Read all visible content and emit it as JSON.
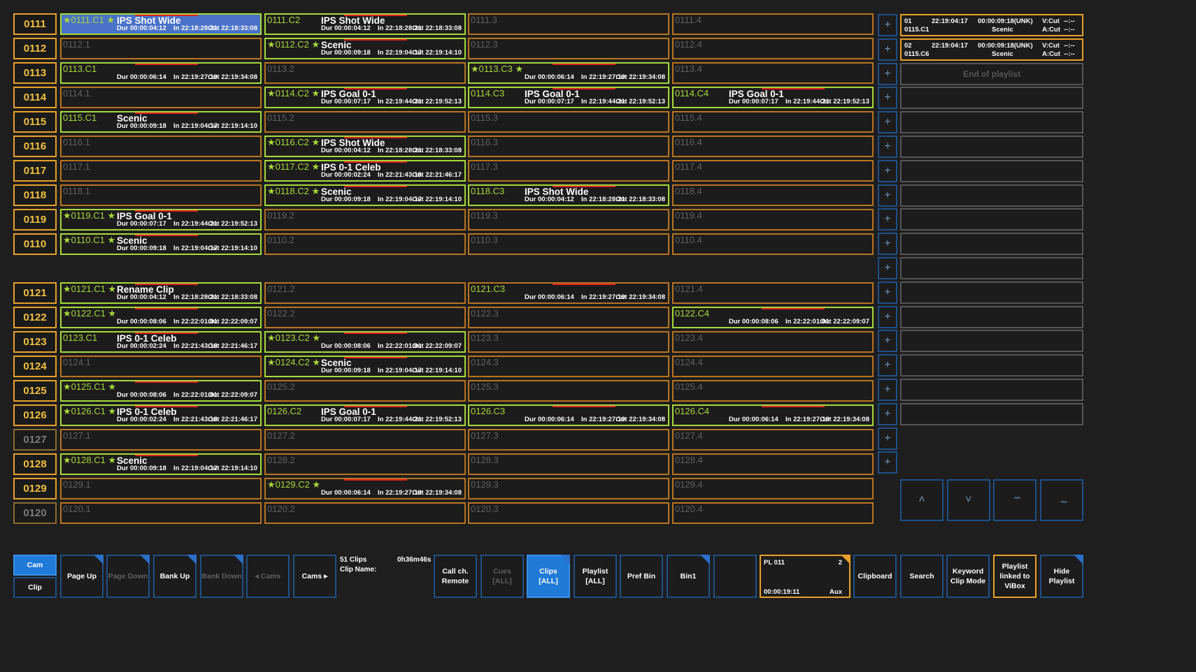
{
  "rows": [
    {
      "label": "0111",
      "dim": false,
      "cells": [
        {
          "id": "0111.C1",
          "star": true,
          "title": "IPS Shot Wide",
          "dur": "Dur 00:00:04:12",
          "in": "In 22:18:28:21",
          "out": "Out 22:18:33:08",
          "selected": true,
          "green": true
        },
        {
          "id": "0111.C2",
          "star": false,
          "title": "IPS Shot Wide",
          "dur": "Dur 00:00:04:12",
          "in": "In 22:18:28:21",
          "out": "Out 22:18:33:08",
          "green": true
        },
        {
          "id": "0111.3"
        },
        {
          "id": "0111.4"
        }
      ]
    },
    {
      "label": "0112",
      "dim": false,
      "cells": [
        {
          "id": "0112.1"
        },
        {
          "id": "0112.C2",
          "star": true,
          "title": "Scenic",
          "dur": "Dur 00:00:09:18",
          "in": "In 22:19:04:17",
          "out": "Out 22:19:14:10",
          "green": true
        },
        {
          "id": "0112.3"
        },
        {
          "id": "0112.4"
        }
      ]
    },
    {
      "label": "0113",
      "dim": false,
      "cells": [
        {
          "id": "0113.C1",
          "star": false,
          "title": "",
          "dur": "Dur 00:00:06:14",
          "in": "In 22:19:27:19",
          "out": "Out 22:19:34:08",
          "green": true
        },
        {
          "id": "0113.2"
        },
        {
          "id": "0113.C3",
          "star": true,
          "title": "",
          "dur": "Dur 00:00:06:14",
          "in": "In 22:19:27:19",
          "out": "Out 22:19:34:08",
          "green": true
        },
        {
          "id": "0113.4"
        }
      ]
    },
    {
      "label": "0114",
      "dim": false,
      "cells": [
        {
          "id": "0114.1"
        },
        {
          "id": "0114.C2",
          "star": true,
          "title": "IPS Goal 0-1",
          "dur": "Dur 00:00:07:17",
          "in": "In 22:19:44:21",
          "out": "Out 22:19:52:13",
          "green": true
        },
        {
          "id": "0114.C3",
          "star": false,
          "title": "IPS Goal 0-1",
          "dur": "Dur 00:00:07:17",
          "in": "In 22:19:44:21",
          "out": "Out 22:19:52:13",
          "green": true
        },
        {
          "id": "0114.C4",
          "star": false,
          "title": "IPS Goal 0-1",
          "dur": "Dur 00:00:07:17",
          "in": "In 22:19:44:21",
          "out": "Out 22:19:52:13",
          "green": true
        }
      ]
    },
    {
      "label": "0115",
      "dim": false,
      "cells": [
        {
          "id": "0115.C1",
          "star": false,
          "title": "Scenic",
          "dur": "Dur 00:00:09:18",
          "in": "In 22:19:04:17",
          "out": "Out 22:19:14:10",
          "green": true
        },
        {
          "id": "0115.2"
        },
        {
          "id": "0115.3"
        },
        {
          "id": "0115.4"
        }
      ]
    },
    {
      "label": "0116",
      "dim": false,
      "cells": [
        {
          "id": "0116.1"
        },
        {
          "id": "0116.C2",
          "star": true,
          "title": "IPS Shot Wide",
          "dur": "Dur 00:00:04:12",
          "in": "In 22:18:28:21",
          "out": "Out 22:18:33:08",
          "green": true
        },
        {
          "id": "0116.3"
        },
        {
          "id": "0116.4"
        }
      ]
    },
    {
      "label": "0117",
      "dim": false,
      "cells": [
        {
          "id": "0117.1"
        },
        {
          "id": "0117.C2",
          "star": true,
          "title": "IPS 0-1 Celeb",
          "dur": "Dur 00:00:02:24",
          "in": "In 22:21:43:18",
          "out": "Out 22:21:46:17",
          "green": true
        },
        {
          "id": "0117.3"
        },
        {
          "id": "0117.4"
        }
      ]
    },
    {
      "label": "0118",
      "dim": false,
      "cells": [
        {
          "id": "0118.1"
        },
        {
          "id": "0118.C2",
          "star": true,
          "title": "Scenic",
          "dur": "Dur 00:00:09:18",
          "in": "In 22:19:04:17",
          "out": "Out 22:19:14:10",
          "green": true
        },
        {
          "id": "0118.C3",
          "star": false,
          "title": "IPS Shot Wide",
          "dur": "Dur 00:00:04:12",
          "in": "In 22:18:28:21",
          "out": "Out 22:18:33:08",
          "green": true
        },
        {
          "id": "0118.4"
        }
      ]
    },
    {
      "label": "0119",
      "dim": false,
      "cells": [
        {
          "id": "0119.C1",
          "star": true,
          "title": "IPS Goal 0-1",
          "dur": "Dur 00:00:07:17",
          "in": "In 22:19:44:21",
          "out": "Out 22:19:52:13",
          "green": true
        },
        {
          "id": "0119.2"
        },
        {
          "id": "0119.3"
        },
        {
          "id": "0119.4"
        }
      ]
    },
    {
      "label": "0110",
      "dim": false,
      "cells": [
        {
          "id": "0110.C1",
          "star": true,
          "title": "Scenic",
          "dur": "Dur 00:00:09:18",
          "in": "In 22:19:04:17",
          "out": "Out 22:19:14:10",
          "green": true
        },
        {
          "id": "0110.2"
        },
        {
          "id": "0110.3"
        },
        {
          "id": "0110.4"
        }
      ]
    },
    {
      "label": "0121",
      "dim": false,
      "cells": [
        {
          "id": "0121.C1",
          "star": true,
          "title": "Rename Clip",
          "dur": "Dur 00:00:04:12",
          "in": "In 22:18:28:21",
          "out": "Out 22:18:33:08",
          "green": true
        },
        {
          "id": "0121.2"
        },
        {
          "id": "0121.C3",
          "star": false,
          "title": "",
          "dur": "Dur 00:00:06:14",
          "in": "In 22:19:27:19",
          "out": "Out 22:19:34:08",
          "green": false
        },
        {
          "id": "0121.4"
        }
      ]
    },
    {
      "label": "0122",
      "dim": false,
      "cells": [
        {
          "id": "0122.C1",
          "star": true,
          "title": "",
          "dur": "Dur 00:00:08:06",
          "in": "In 22:22:01:01",
          "out": "Out 22:22:09:07",
          "green": true
        },
        {
          "id": "0122.2"
        },
        {
          "id": "0122.3"
        },
        {
          "id": "0122.C4",
          "star": false,
          "title": "",
          "dur": "Dur 00:00:08:06",
          "in": "In 22:22:01:01",
          "out": "Out 22:22:09:07",
          "green": true
        }
      ]
    },
    {
      "label": "0123",
      "dim": false,
      "cells": [
        {
          "id": "0123.C1",
          "star": false,
          "title": "IPS 0-1 Celeb",
          "dur": "Dur 00:00:02:24",
          "in": "In 22:21:43:18",
          "out": "Out 22:21:46:17",
          "green": true
        },
        {
          "id": "0123.C2",
          "star": true,
          "title": "",
          "dur": "Dur 00:00:08:06",
          "in": "In 22:22:01:01",
          "out": "Out 22:22:09:07",
          "green": true
        },
        {
          "id": "0123.3"
        },
        {
          "id": "0123.4"
        }
      ]
    },
    {
      "label": "0124",
      "dim": false,
      "cells": [
        {
          "id": "0124.1"
        },
        {
          "id": "0124.C2",
          "star": true,
          "title": "Scenic",
          "dur": "Dur 00:00:09:18",
          "in": "In 22:19:04:17",
          "out": "Out 22:19:14:10",
          "green": true
        },
        {
          "id": "0124.3"
        },
        {
          "id": "0124.4"
        }
      ]
    },
    {
      "label": "0125",
      "dim": false,
      "cells": [
        {
          "id": "0125.C1",
          "star": true,
          "title": "",
          "dur": "Dur 00:00:08:06",
          "in": "In 22:22:01:01",
          "out": "Out 22:22:09:07",
          "green": true
        },
        {
          "id": "0125.2"
        },
        {
          "id": "0125.3"
        },
        {
          "id": "0125.4"
        }
      ]
    },
    {
      "label": "0126",
      "dim": false,
      "cells": [
        {
          "id": "0126.C1",
          "star": true,
          "title": "IPS 0-1 Celeb",
          "dur": "Dur 00:00:02:24",
          "in": "In 22:21:43:18",
          "out": "Out 22:21:46:17",
          "green": true
        },
        {
          "id": "0126.C2",
          "star": false,
          "title": "IPS Goal 0-1",
          "dur": "Dur 00:00:07:17",
          "in": "In 22:19:44:21",
          "out": "Out 22:19:52:13",
          "green": true
        },
        {
          "id": "0126.C3",
          "star": false,
          "title": "",
          "dur": "Dur 00:00:06:14",
          "in": "In 22:19:27:19",
          "out": "Out 22:19:34:08",
          "green": true
        },
        {
          "id": "0126.C4",
          "star": false,
          "title": "",
          "dur": "Dur 00:00:06:14",
          "in": "In 22:19:27:19",
          "out": "Out 22:19:34:08",
          "green": true
        }
      ]
    },
    {
      "label": "0127",
      "dim": true,
      "cells": [
        {
          "id": "0127.1"
        },
        {
          "id": "0127.2"
        },
        {
          "id": "0127.3"
        },
        {
          "id": "0127.4"
        }
      ]
    },
    {
      "label": "0128",
      "dim": false,
      "cells": [
        {
          "id": "0128.C1",
          "star": true,
          "title": "Scenic",
          "dur": "Dur 00:00:09:18",
          "in": "In 22:19:04:17",
          "out": "Out 22:19:14:10",
          "green": true
        },
        {
          "id": "0128.2"
        },
        {
          "id": "0128.3"
        },
        {
          "id": "0128.4"
        }
      ]
    },
    {
      "label": "0129",
      "dim": false,
      "cells": [
        {
          "id": "0129.1"
        },
        {
          "id": "0129.C2",
          "star": true,
          "title": "",
          "dur": "Dur 00:00:06:14",
          "in": "In 22:19:27:19",
          "out": "Out 22:19:34:08",
          "green": false
        },
        {
          "id": "0129.3"
        },
        {
          "id": "0129.4"
        }
      ]
    },
    {
      "label": "0120",
      "dim": true,
      "cells": [
        {
          "id": "0120.1"
        },
        {
          "id": "0120.2"
        },
        {
          "id": "0120.3"
        },
        {
          "id": "0120.4"
        }
      ]
    }
  ],
  "plus_label": "+",
  "playlist": {
    "items": [
      {
        "num": "01",
        "clip": "0115.C1",
        "time": "22:19:04:17",
        "dur": "00:00:09:18(UNK)",
        "name": "Scenic",
        "v": "V:Cut",
        "a": "A:Cut",
        "vt": "--:--",
        "at": "--:--"
      },
      {
        "num": "02",
        "clip": "0115.C6",
        "time": "22:19:04:17",
        "dur": "00:00:09:18(UNK)",
        "name": "Scenic",
        "v": "V:Cut",
        "a": "A:Cut",
        "vt": "--:--",
        "at": "--:--"
      }
    ],
    "end_label": "End of playlist",
    "nav": [
      "˄",
      "˅",
      "⌃⌃",
      "⌄⌄"
    ]
  },
  "toolbar": {
    "cam": "Cam",
    "clip": "Clip",
    "page_up": "Page Up",
    "page_down": "Page Down",
    "bank_up": "Bank Up",
    "bank_down": "Bank Down",
    "cams_prev": "◂  Cams",
    "cams_next": "Cams  ▸",
    "clips_count": "51 Clips",
    "clips_time": "0h36m46s",
    "clip_name_label": "Clip Name:",
    "call_remote": "Call ch.\nRemote",
    "cues": "Cues\n[ALL]",
    "clips_all": "Clips\n[ALL]",
    "playlist_all": "Playlist\n[ALL]",
    "pref_bin": "Pref Bin",
    "bin1": "Bin1",
    "blank": "",
    "pl_name": "PL 011",
    "pl_num": "2",
    "pl_time": "00:00:19:11",
    "pl_aux": "Aux",
    "clipboard": "Clipboard",
    "search": "Search",
    "keyword": "Keyword\nClip Mode",
    "linked": "Playlist\nlinked to\nViBox",
    "hide_playlist": "Hide Playlist"
  },
  "colors": {
    "accent_orange": "#e8a02a",
    "clip_green": "#a8d83a",
    "selected_blue": "#4a72c8",
    "active_blue": "#1f7ad8",
    "edge_blue": "#1f4f86"
  }
}
